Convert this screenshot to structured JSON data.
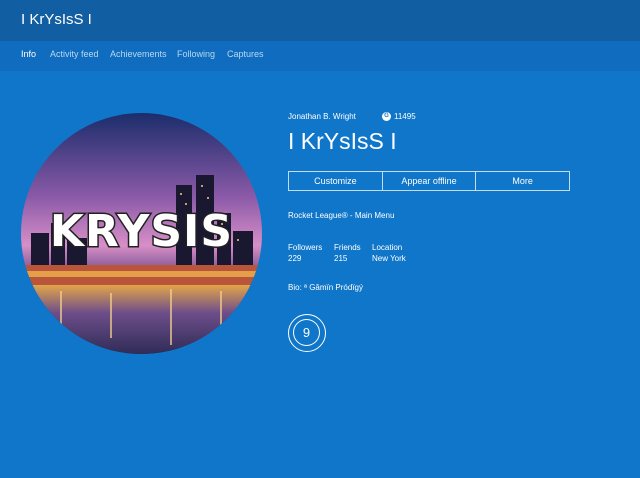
{
  "app": {
    "title": "I KrYsIsS I"
  },
  "tabs": [
    {
      "label": "Info",
      "active": true
    },
    {
      "label": "Activity feed",
      "active": false
    },
    {
      "label": "Achievements",
      "active": false
    },
    {
      "label": "Following",
      "active": false
    },
    {
      "label": "Captures",
      "active": false
    }
  ],
  "profile": {
    "real_name": "Jonathan B. Wright",
    "gamerscore_icon": "G",
    "gamerscore": "11495",
    "gamertag": "I KrYsIsS I",
    "avatar_text": "KRYSIS",
    "presence": "Rocket League® - Main Menu",
    "bio": "Bio: ª Gâmïn Pródïgý",
    "reputation": "9"
  },
  "actions": {
    "customize": "Customize",
    "appear_offline": "Appear offline",
    "more": "More"
  },
  "stats": {
    "followers_label": "Followers",
    "followers_value": "229",
    "friends_label": "Friends",
    "friends_value": "215",
    "location_label": "Location",
    "location_value": "New York"
  },
  "colors": {
    "background": "#0f76c9",
    "titlebar": "#115ea3",
    "tab_inactive": "#b9d8f2",
    "text": "#ffffff"
  }
}
